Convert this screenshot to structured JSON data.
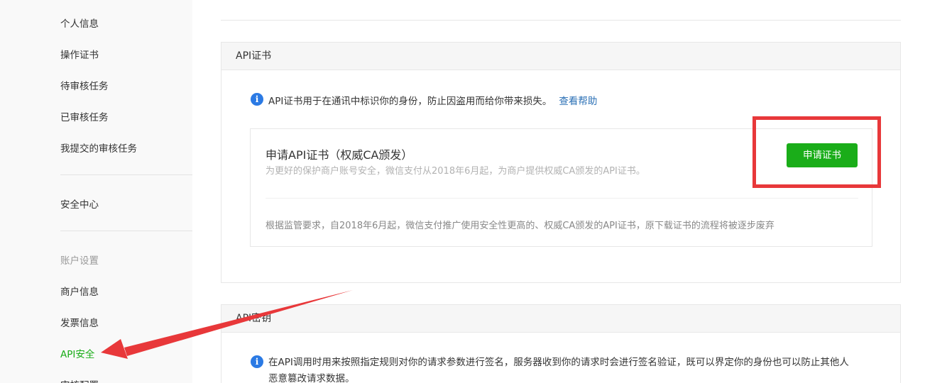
{
  "sidebar": {
    "items": [
      {
        "label": "个人信息"
      },
      {
        "label": "操作证书"
      },
      {
        "label": "待审核任务"
      },
      {
        "label": "已审核任务"
      },
      {
        "label": "我提交的审核任务"
      },
      {
        "label": "安全中心"
      }
    ],
    "account_group_title": "账户设置",
    "account_items": [
      {
        "label": "商户信息"
      },
      {
        "label": "发票信息"
      },
      {
        "label": "API安全"
      },
      {
        "label": "审核配置"
      }
    ]
  },
  "main": {
    "cert_panel": {
      "title": "API证书",
      "notice": "API证书用于在通讯中标识你的身份，防止因盗用而给你带来损失。",
      "help_link": "查看帮助",
      "apply_title": "申请API证书（权威CA颁发）",
      "apply_desc": "为更好的保护商户账号安全，微信支付从2018年6月起，为商户提供权威CA颁发的API证书。",
      "apply_button": "申请证书",
      "note": "根据监管要求，自2018年6月起，微信支付推广使用安全性更高的、权威CA颁发的API证书，原下载证书的流程将被逐步废弃"
    },
    "key_panel": {
      "title": "API密钥",
      "notice_line1": "在API调用时用来按照指定规则对你的请求参数进行签名，服务器收到你的请求时会进行签名验证，既可以界定你的身份也可以防止其他人",
      "notice_line2": "恶意篡改请求数据。"
    }
  },
  "annotations": {
    "highlight_color": "#e8383a",
    "arrow_color": "#e8383a"
  },
  "colors": {
    "accent_green": "#1aad19",
    "info_blue": "#2b7ae4",
    "link_blue": "#2a6fb5"
  }
}
